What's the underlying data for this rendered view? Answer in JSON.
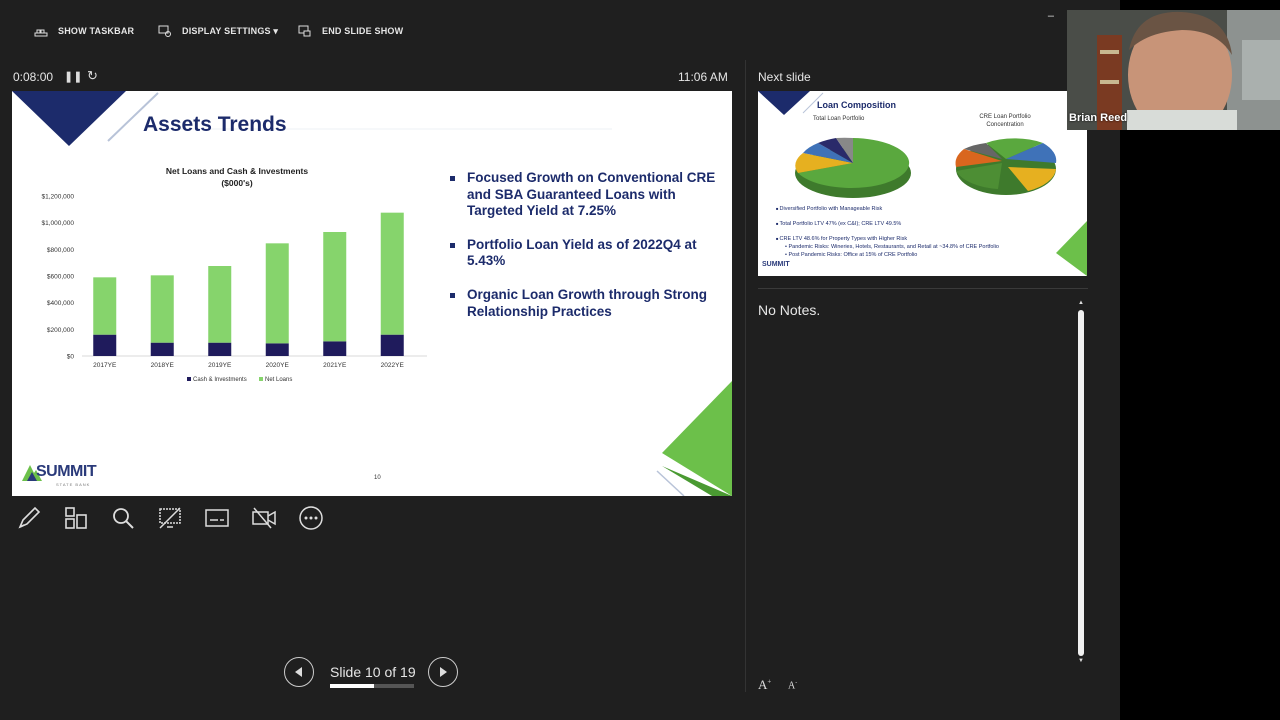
{
  "toolbar": {
    "show_taskbar": "SHOW TASKBAR",
    "display_settings": "DISPLAY SETTINGS ▾",
    "end_slide_show": "END SLIDE SHOW"
  },
  "presenter": {
    "timer": "0:08:00",
    "clock": "11:06 AM",
    "next_slide_label": "Next slide",
    "notes": "No Notes.",
    "slide_counter": "Slide 10 of 19",
    "progress_fraction": 0.526
  },
  "current_slide": {
    "title": "Assets Trends",
    "chart_title_line1": "Net Loans and Cash & Investments",
    "chart_title_line2": "($000's)",
    "bullets": [
      "Focused Growth on Conventional CRE and SBA Guaranteed Loans with Targeted Yield at 7.25%",
      "Portfolio Loan Yield as of 2022Q4 at 5.43%",
      "Organic Loan Growth through Strong Relationship Practices"
    ],
    "logo": "SUMMIT",
    "logo_sub": "STATE BANK",
    "page_number": "10"
  },
  "chart_data": {
    "type": "bar",
    "stacked": true,
    "title": "Net Loans and Cash & Investments ($000's)",
    "categories": [
      "2017YE",
      "2018YE",
      "2019YE",
      "2020YE",
      "2021YE",
      "2022YE"
    ],
    "series": [
      {
        "name": "Cash & Investments",
        "color": "#1f1b5c",
        "values": [
          160000,
          100000,
          100000,
          95000,
          110000,
          160000
        ]
      },
      {
        "name": "Net Loans",
        "color": "#86d46c",
        "values": [
          430000,
          505000,
          575000,
          750000,
          820000,
          915000
        ]
      }
    ],
    "ylim": [
      0,
      1200000
    ],
    "yticks": [
      "$0",
      "$200,000",
      "$400,000",
      "$600,000",
      "$800,000",
      "$1,000,000",
      "$1,200,000"
    ],
    "legend": "bottom"
  },
  "next_slide": {
    "title": "Loan Composition",
    "subtitle_left": "Total Loan Portfolio",
    "subtitle_right_line1": "CRE Loan Portfolio",
    "subtitle_right_line2": "Concentration",
    "bullets": [
      "Diversified Portfolio with Manageable Risk",
      "Total Portfolio LTV 47% (ex C&I); CRE LTV 49.5%",
      "CRE LTV 48.6% for Property Types with Higher Risk"
    ],
    "sub_bullets": [
      "Pandemic Risks: Wineries, Hotels, Restaurants, and Retail at ~34.8% of CRE Portfolio",
      "Post Pandemic Risks:  Office at 15% of CRE Portfolio"
    ],
    "logo": "SUMMIT"
  },
  "video": {
    "participant_name": "Brian Reed"
  },
  "colors": {
    "navy": "#1c2b6b",
    "green": "#6cc04a",
    "background": "#1f1f1f"
  }
}
